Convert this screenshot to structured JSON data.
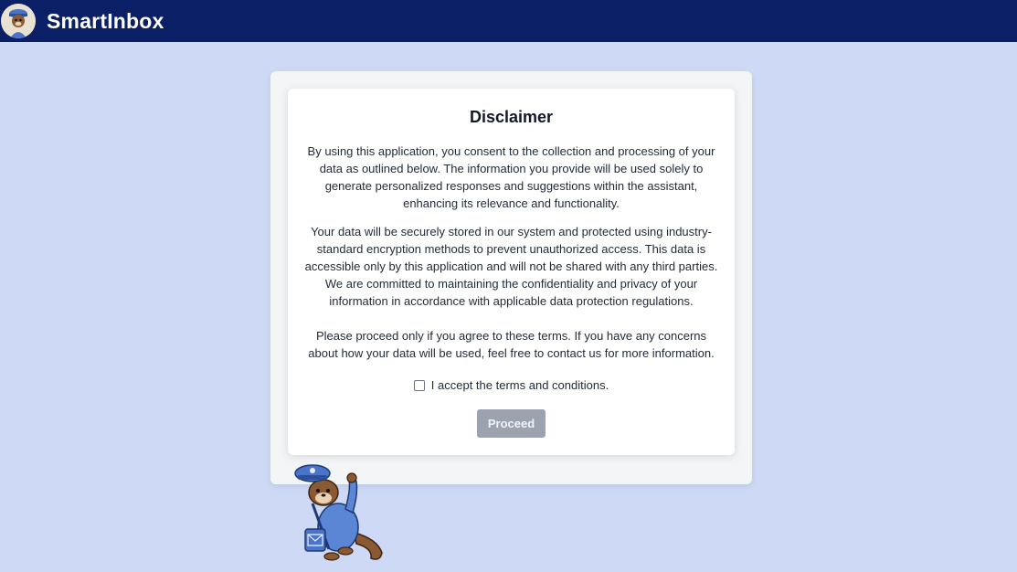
{
  "header": {
    "brand": "SmartInbox",
    "logo_icon": "otter-mail-carrier-icon"
  },
  "disclaimer": {
    "title": "Disclaimer",
    "paragraph_1": "By using this application, you consent to the collection and processing of your data as outlined below. The information you provide will be used solely to generate personalized responses and suggestions within the assistant, enhancing its relevance and functionality.",
    "paragraph_2": "Your data will be securely stored in our system and protected using industry-standard encryption methods to prevent unauthorized access. This data is accessible only by this application and will not be shared with any third parties. We are committed to maintaining the confidentiality and privacy of your information in accordance with applicable data protection regulations.",
    "paragraph_3": "Please proceed only if you agree to these terms. If you have any concerns about how your data will be used, feel free to contact us for more information.",
    "accept_label": "I accept the terms and conditions.",
    "accept_checked": false,
    "proceed_label": "Proceed"
  },
  "colors": {
    "header_bg": "#0b1f66",
    "page_bg": "#cdd9f5",
    "button_disabled": "#9ca3af"
  }
}
